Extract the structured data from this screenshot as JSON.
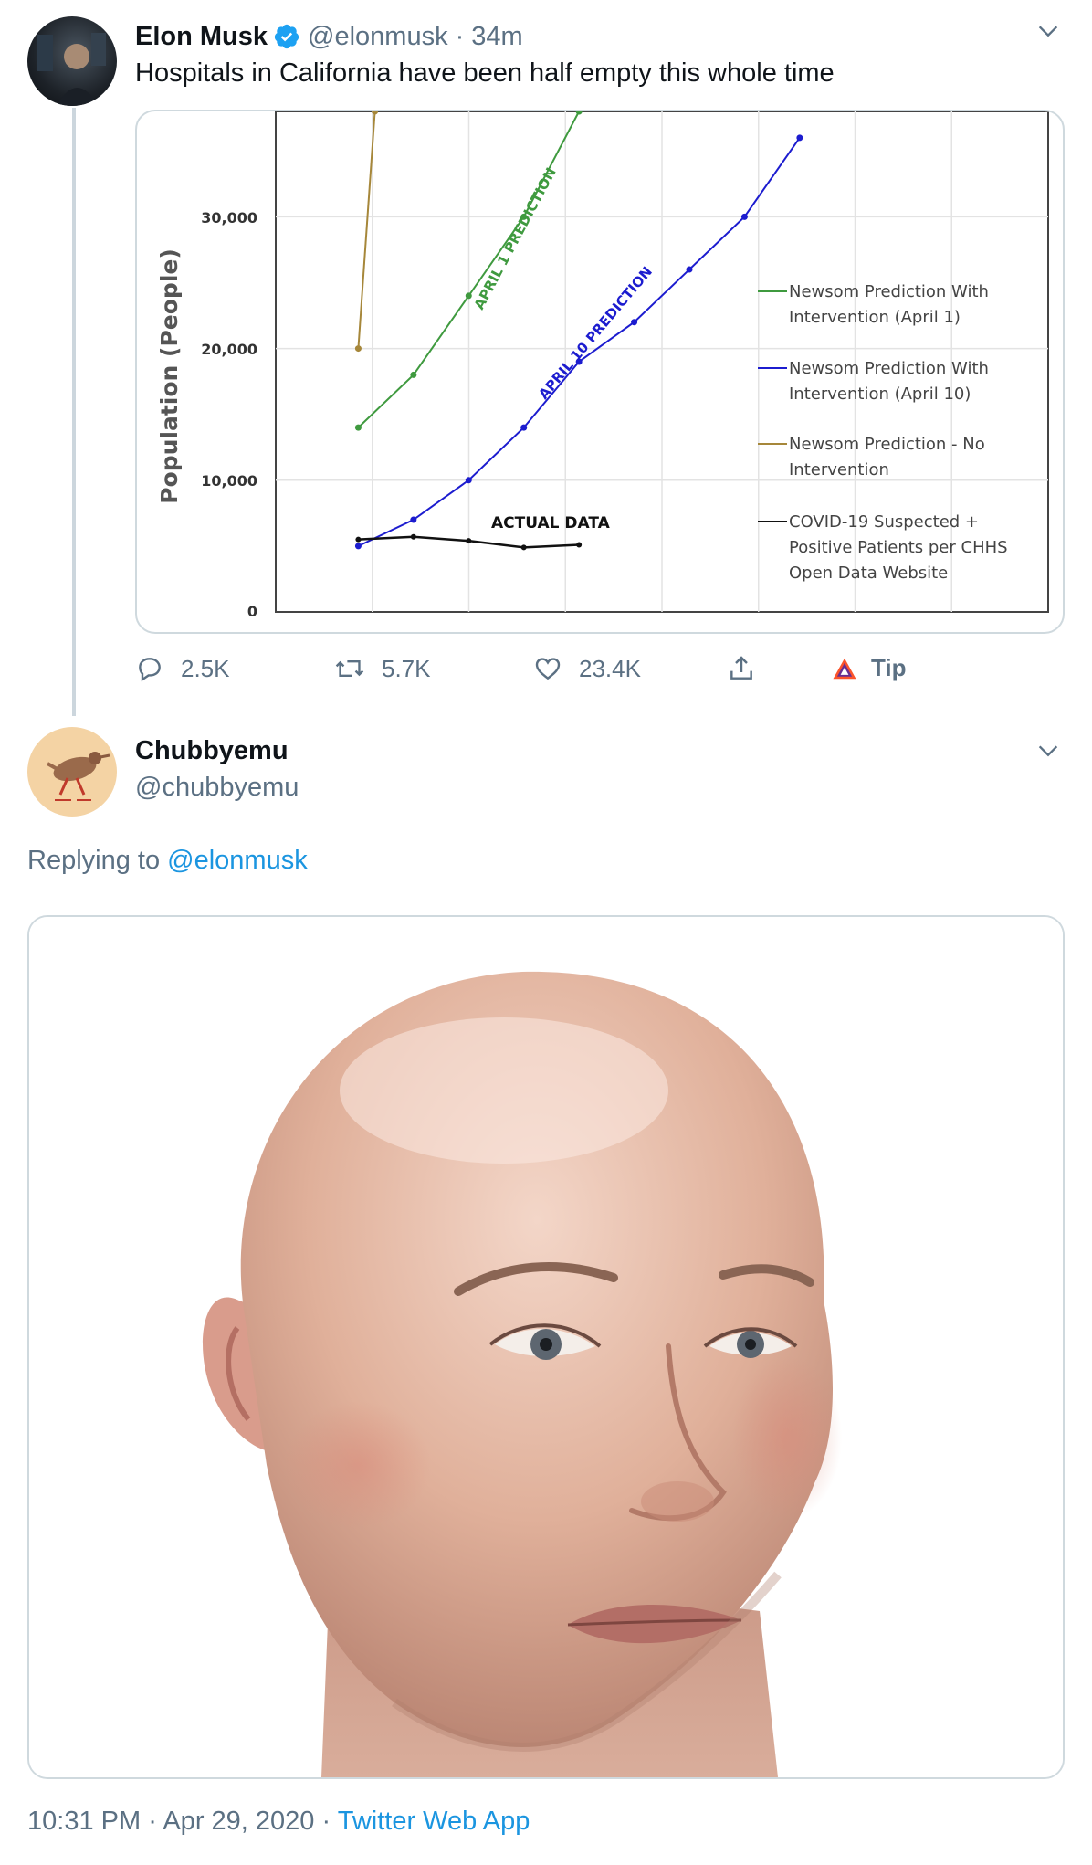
{
  "tweet": {
    "author_name": "Elon Musk",
    "handle": "@elonmusk",
    "separator": "·",
    "time_ago": "34m",
    "text": "Hospitals in California have been half empty this whole time",
    "actions": {
      "replies": "2.5K",
      "retweets": "5.7K",
      "likes": "23.4K",
      "tip": "Tip"
    }
  },
  "reply": {
    "author_name": "Chubbyemu",
    "handle": "@chubbyemu",
    "replying_prefix": "Replying to",
    "replying_to": "@elonmusk",
    "footer": {
      "time": "10:31 PM",
      "date": "Apr 29, 2020",
      "source": "Twitter Web App",
      "dot": "·"
    }
  },
  "icons": {
    "verified": "verified-badge-icon",
    "chevron": "chevron-down-icon",
    "reply": "reply-icon",
    "retweet": "retweet-icon",
    "like": "heart-icon",
    "share": "share-icon",
    "tip": "tip-icon"
  },
  "colors": {
    "accent": "#1b95e0",
    "muted": "#5b7083",
    "april1": "#3f9a3f",
    "april10": "#1c1ccf",
    "no_intervention": "#a6873a",
    "actual": "#111111"
  },
  "chart_data": {
    "type": "line",
    "ylabel": "Population (People)",
    "y_ticks": [
      "0",
      "10,000",
      "20,000",
      "30,000"
    ],
    "ylim": [
      0,
      38000
    ],
    "grid": true,
    "legend_position": "right",
    "annotations": [
      "APRIL 1 PREDICTION",
      "APRIL 10 PREDICTION",
      "ACTUAL DATA"
    ],
    "series": [
      {
        "name": "Newsom Prediction With Intervention (April 1)",
        "color": "#3f9a3f",
        "points": [
          [
            1,
            14000
          ],
          [
            2,
            18000
          ],
          [
            3,
            24000
          ],
          [
            4,
            30000
          ],
          [
            5,
            38000
          ]
        ]
      },
      {
        "name": "Newsom Prediction With Intervention (April 10)",
        "color": "#1c1ccf",
        "points": [
          [
            1,
            5000
          ],
          [
            2,
            7000
          ],
          [
            3,
            10000
          ],
          [
            4,
            14000
          ],
          [
            5,
            19000
          ],
          [
            6,
            22000
          ],
          [
            7,
            26000
          ],
          [
            8,
            30000
          ],
          [
            9,
            36000
          ]
        ]
      },
      {
        "name": "Newsom Prediction - No Intervention",
        "color": "#a6873a",
        "points": [
          [
            1,
            20000
          ],
          [
            1.3,
            38000
          ]
        ]
      },
      {
        "name": "COVID-19 Suspected + Positive Patients per CHHS Open Data Website",
        "color": "#111111",
        "points": [
          [
            1,
            5500
          ],
          [
            2,
            5700
          ],
          [
            3,
            5400
          ],
          [
            4,
            4900
          ],
          [
            5,
            5100
          ]
        ]
      }
    ]
  }
}
